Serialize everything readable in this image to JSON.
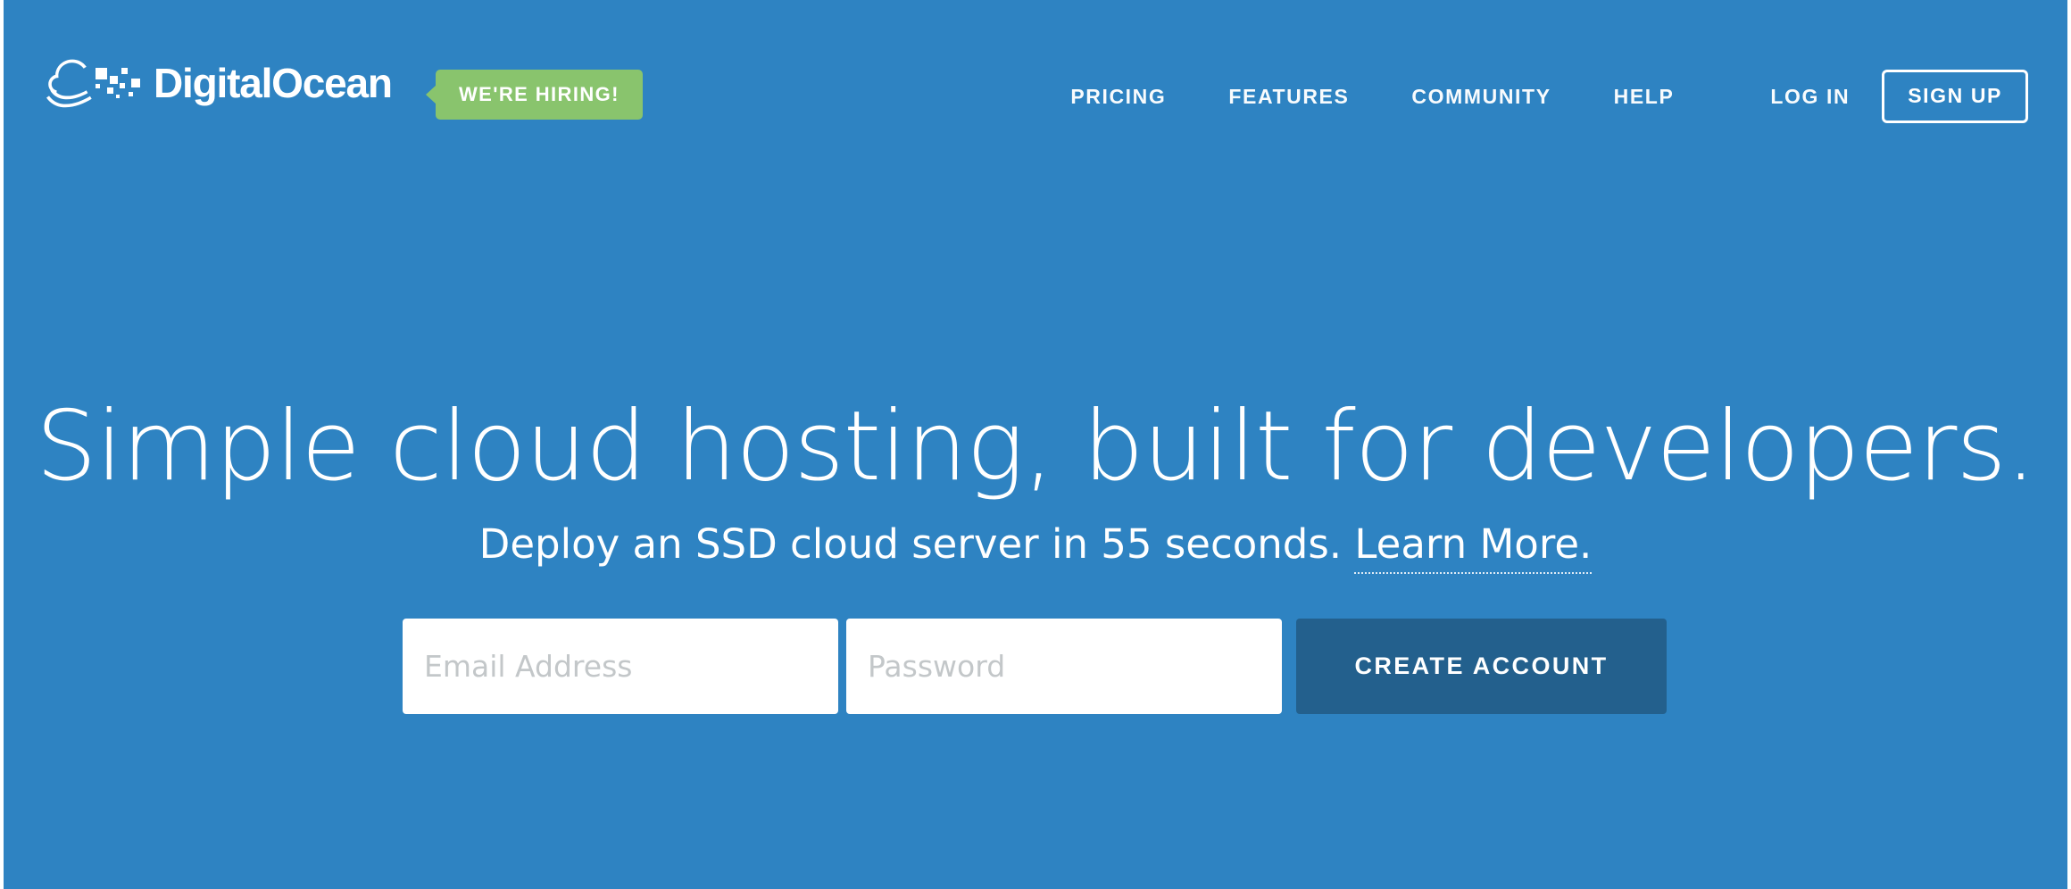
{
  "colors": {
    "hero_background": "#2e83c2",
    "badge_green": "#89c46d",
    "button_dark_blue": "#23608d",
    "text_white": "#ffffff",
    "placeholder_gray": "#c3c7c9"
  },
  "header": {
    "brand": {
      "logo_icon": "digitalocean-cloud-logo",
      "wordmark": "DigitalOcean"
    },
    "hiring_badge": {
      "label": "WE'RE HIRING!"
    },
    "nav_links": [
      {
        "label": "PRICING",
        "name": "nav-link-pricing"
      },
      {
        "label": "FEATURES",
        "name": "nav-link-features"
      },
      {
        "label": "COMMUNITY",
        "name": "nav-link-community"
      },
      {
        "label": "HELP",
        "name": "nav-link-help"
      }
    ],
    "login_label": "LOG IN",
    "signup_label": "SIGN UP"
  },
  "hero": {
    "headline": "Simple cloud hosting, built for developers.",
    "subheadline_prefix": "Deploy an SSD cloud server in 55 seconds. ",
    "learn_more_label": "Learn More."
  },
  "form": {
    "email_placeholder": "Email Address",
    "email_value": "",
    "password_placeholder": "Password",
    "password_value": "",
    "submit_label": "CREATE ACCOUNT"
  }
}
